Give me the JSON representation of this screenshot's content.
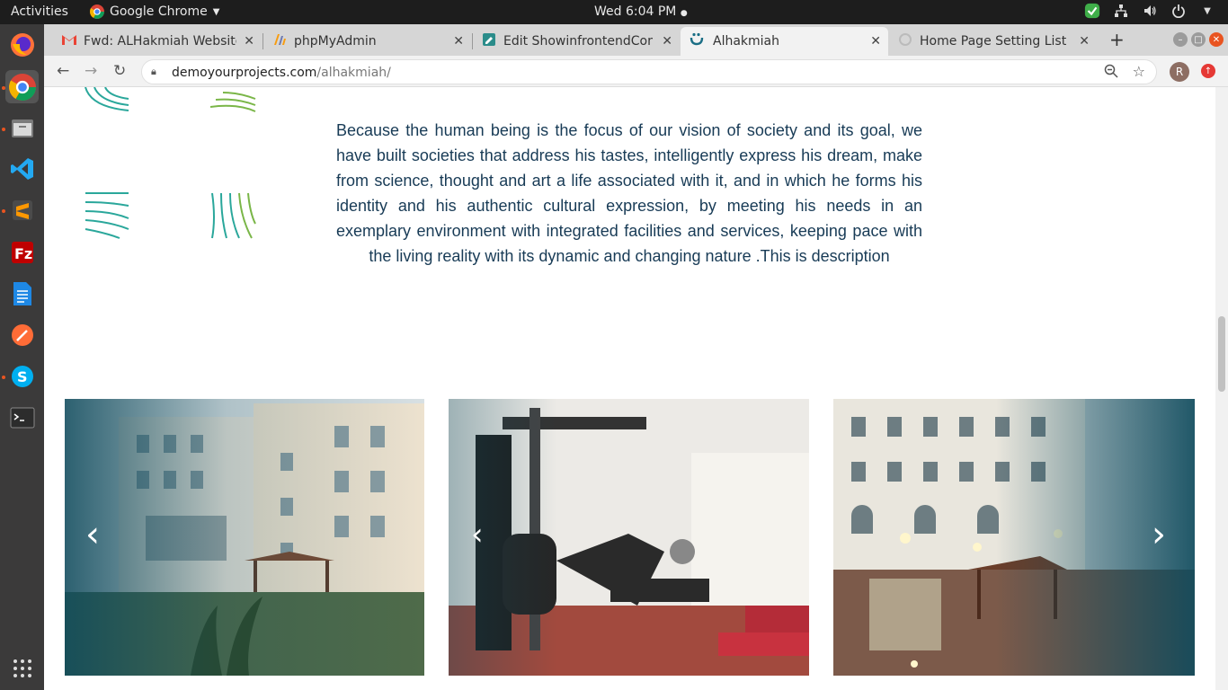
{
  "system": {
    "activities": "Activities",
    "app_name": "Google Chrome",
    "clock": "Wed  6:04 PM"
  },
  "browser": {
    "tabs": [
      {
        "title": "Fwd: ALHakmiah Website",
        "icon": "gmail-icon"
      },
      {
        "title": "phpMyAdmin",
        "icon": "phpmyadmin-icon"
      },
      {
        "title": "Edit ShowinfrontendCon",
        "icon": "edit-page-icon"
      },
      {
        "title": "Alhakmiah",
        "icon": "alhakmiah-favicon",
        "active": true
      },
      {
        "title": "Home Page Setting List",
        "icon": "loading-icon"
      }
    ],
    "url_host": "demoyourprojects.com",
    "url_path": "/alhakmiah/",
    "profile_initial": "R"
  },
  "page": {
    "description": "Because the human being is the focus of our vision of society and its goal, we have built societies that address his tastes, intelligently express his dream, make from science, thought and art a life associated with it, and in which he forms his identity and his authentic cultural expression, by meeting his needs in an exemplary environment with integrated facilities and services, keeping pace with the living reality with its dynamic and changing nature .This is description",
    "slides": [
      {
        "subject": "residential-building-courtyard"
      },
      {
        "subject": "gym-equipment"
      },
      {
        "subject": "courtyard-pergola-night"
      }
    ],
    "prev_arrow": "‹",
    "next_arrow": "›",
    "colors": {
      "text": "#183b56",
      "teal": "#2aa79b",
      "green": "#7ab648",
      "overlay": "#0e4a5c"
    }
  }
}
